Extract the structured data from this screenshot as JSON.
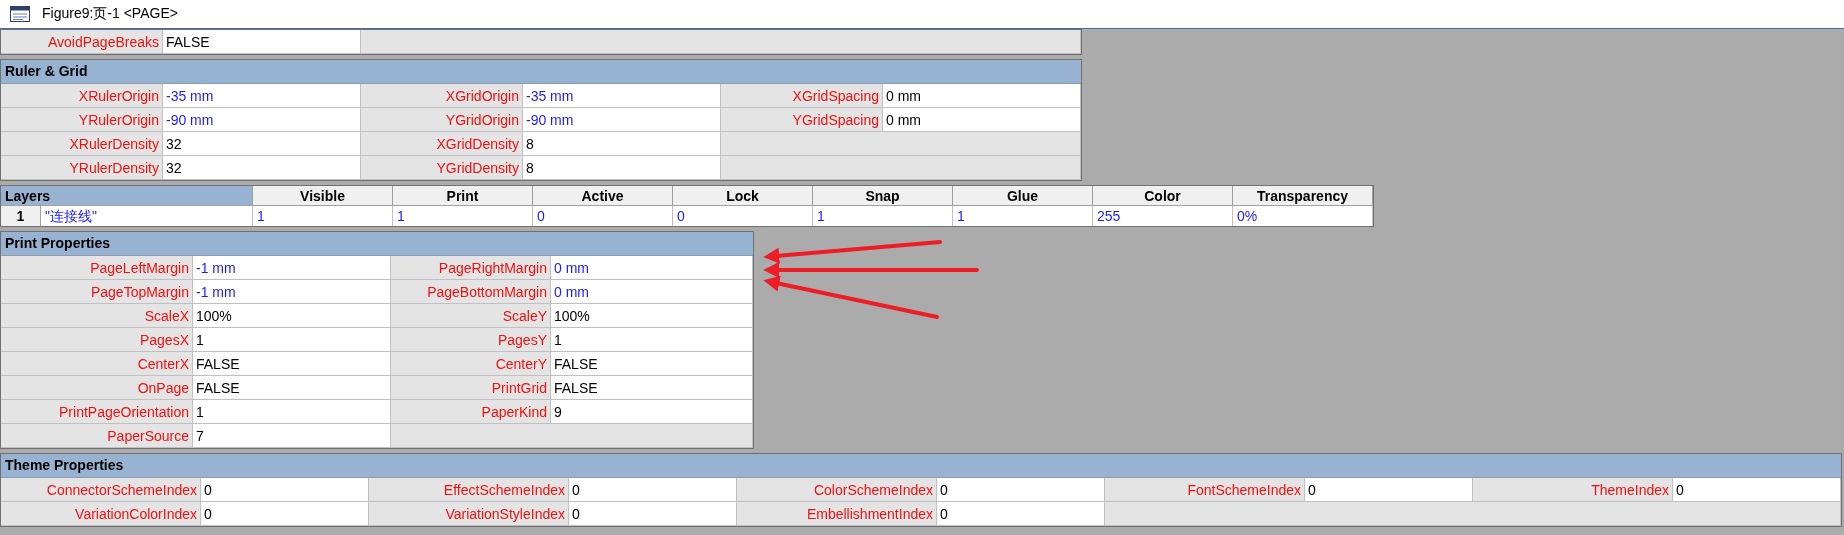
{
  "window": {
    "title": "Figure9:页-1 <PAGE>"
  },
  "top_rows": [
    [
      {
        "label": "AvoidPageBreaks",
        "value": "FALSE",
        "color": "#000000"
      }
    ]
  ],
  "sections": [
    {
      "title": "Ruler & Grid",
      "rows": [
        [
          {
            "label": "XRulerOrigin",
            "value": "-35 mm",
            "color": "#1a1aff"
          },
          {
            "label": "XGridOrigin",
            "value": "-35 mm",
            "color": "#1a1aff"
          },
          {
            "label": "XGridSpacing",
            "value": "0 mm",
            "color": "#000000"
          }
        ],
        [
          {
            "label": "YRulerOrigin",
            "value": "-90 mm",
            "color": "#1a1aff"
          },
          {
            "label": "YGridOrigin",
            "value": "-90 mm",
            "color": "#1a1aff"
          },
          {
            "label": "YGridSpacing",
            "value": "0 mm",
            "color": "#000000"
          }
        ],
        [
          {
            "label": "XRulerDensity",
            "value": "32",
            "color": "#000000"
          },
          {
            "label": "XGridDensity",
            "value": "8",
            "color": "#000000"
          }
        ],
        [
          {
            "label": "YRulerDensity",
            "value": "32",
            "color": "#000000"
          },
          {
            "label": "YGridDensity",
            "value": "8",
            "color": "#000000"
          }
        ]
      ]
    },
    {
      "kind": "layers",
      "title": "Layers",
      "columns": [
        "Visible",
        "Print",
        "Active",
        "Lock",
        "Snap",
        "Glue",
        "Color",
        "Transparency"
      ],
      "rows": [
        {
          "index": "1",
          "name": "\"连接线\"",
          "values": [
            "1",
            "1",
            "0",
            "0",
            "1",
            "1",
            "255",
            "0%"
          ]
        }
      ]
    },
    {
      "title": "Print Properties",
      "rows": [
        [
          {
            "label": "PageLeftMargin",
            "value": "-1 mm",
            "color": "#1a1aff"
          },
          {
            "label": "PageRightMargin",
            "value": "0 mm",
            "color": "#1a1aff"
          }
        ],
        [
          {
            "label": "PageTopMargin",
            "value": "-1 mm",
            "color": "#1a1aff"
          },
          {
            "label": "PageBottomMargin",
            "value": "0 mm",
            "color": "#1a1aff"
          }
        ],
        [
          {
            "label": "ScaleX",
            "value": "100%",
            "color": "#000000"
          },
          {
            "label": "ScaleY",
            "value": "100%",
            "color": "#000000"
          }
        ],
        [
          {
            "label": "PagesX",
            "value": "1",
            "color": "#000000"
          },
          {
            "label": "PagesY",
            "value": "1",
            "color": "#000000"
          }
        ],
        [
          {
            "label": "CenterX",
            "value": "FALSE",
            "color": "#000000"
          },
          {
            "label": "CenterY",
            "value": "FALSE",
            "color": "#000000"
          }
        ],
        [
          {
            "label": "OnPage",
            "value": "FALSE",
            "color": "#000000"
          },
          {
            "label": "PrintGrid",
            "value": "FALSE",
            "color": "#000000"
          }
        ],
        [
          {
            "label": "PrintPageOrientation",
            "value": "1",
            "color": "#000000"
          },
          {
            "label": "PaperKind",
            "value": "9",
            "color": "#000000"
          }
        ],
        [
          {
            "label": "PaperSource",
            "value": "7",
            "color": "#000000"
          }
        ]
      ]
    },
    {
      "title": "Theme Properties",
      "rows": [
        [
          {
            "label": "ConnectorSchemeIndex",
            "value": "0",
            "color": "#000000"
          },
          {
            "label": "EffectSchemeIndex",
            "value": "0",
            "color": "#000000"
          },
          {
            "label": "ColorSchemeIndex",
            "value": "0",
            "color": "#000000"
          },
          {
            "label": "FontSchemeIndex",
            "value": "0",
            "color": "#000000"
          },
          {
            "label": "ThemeIndex",
            "value": "0",
            "color": "#000000"
          }
        ],
        [
          {
            "label": "VariationColorIndex",
            "value": "0",
            "color": "#000000"
          },
          {
            "label": "VariationStyleIndex",
            "value": "0",
            "color": "#000000"
          },
          {
            "label": "EmbellishmentIndex",
            "value": "0",
            "color": "#000000"
          }
        ]
      ]
    }
  ],
  "annotations": [
    {
      "kind": "arrow"
    },
    {
      "kind": "arrow"
    },
    {
      "kind": "arrow"
    }
  ]
}
